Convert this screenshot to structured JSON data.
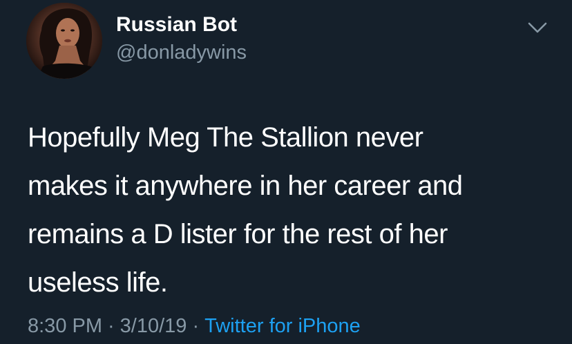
{
  "user": {
    "display_name": "Russian Bot",
    "handle": "@donladywins"
  },
  "tweet": {
    "text_lines": [
      "Hopefully Meg The Stallion never",
      "makes it anywhere in her career and",
      "remains a D lister for the rest of her",
      "useless life."
    ],
    "time": "8:30 PM",
    "separator": "·",
    "date": "3/10/19",
    "source": "Twitter for iPhone"
  },
  "icons": {
    "avatar": "avatar-photo",
    "menu": "chevron-down-icon"
  },
  "colors": {
    "background": "#15202b",
    "primary_text": "#ffffff",
    "secondary_text": "#8899a6",
    "link": "#1da1f2"
  }
}
